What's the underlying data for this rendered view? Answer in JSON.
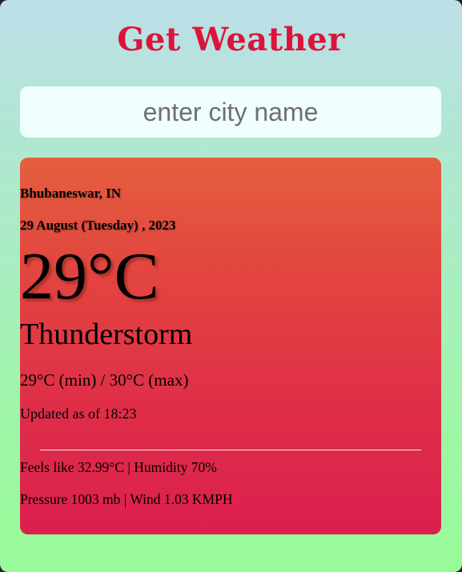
{
  "app": {
    "title": "Get Weather"
  },
  "search": {
    "placeholder": "enter city name",
    "value": ""
  },
  "weather": {
    "location": "Bhubaneswar, IN",
    "date": "29 August (Tuesday) , 2023",
    "temperature": "29°C",
    "condition": "Thunderstorm",
    "min_max": "29°C (min) / 30°C (max)",
    "updated": "Updated as of 18:23",
    "feels_humidity": "Feels like 32.99°C | Humidity 70%",
    "pressure_wind": "Pressure 1003 mb | Wind 1.03 KMPH"
  },
  "colors": {
    "title": "#dc143c",
    "card_top": "#e45f3f",
    "card_bottom": "#dc1f4e",
    "background_top": "#bddfe8",
    "background_bottom": "#98fb98"
  }
}
